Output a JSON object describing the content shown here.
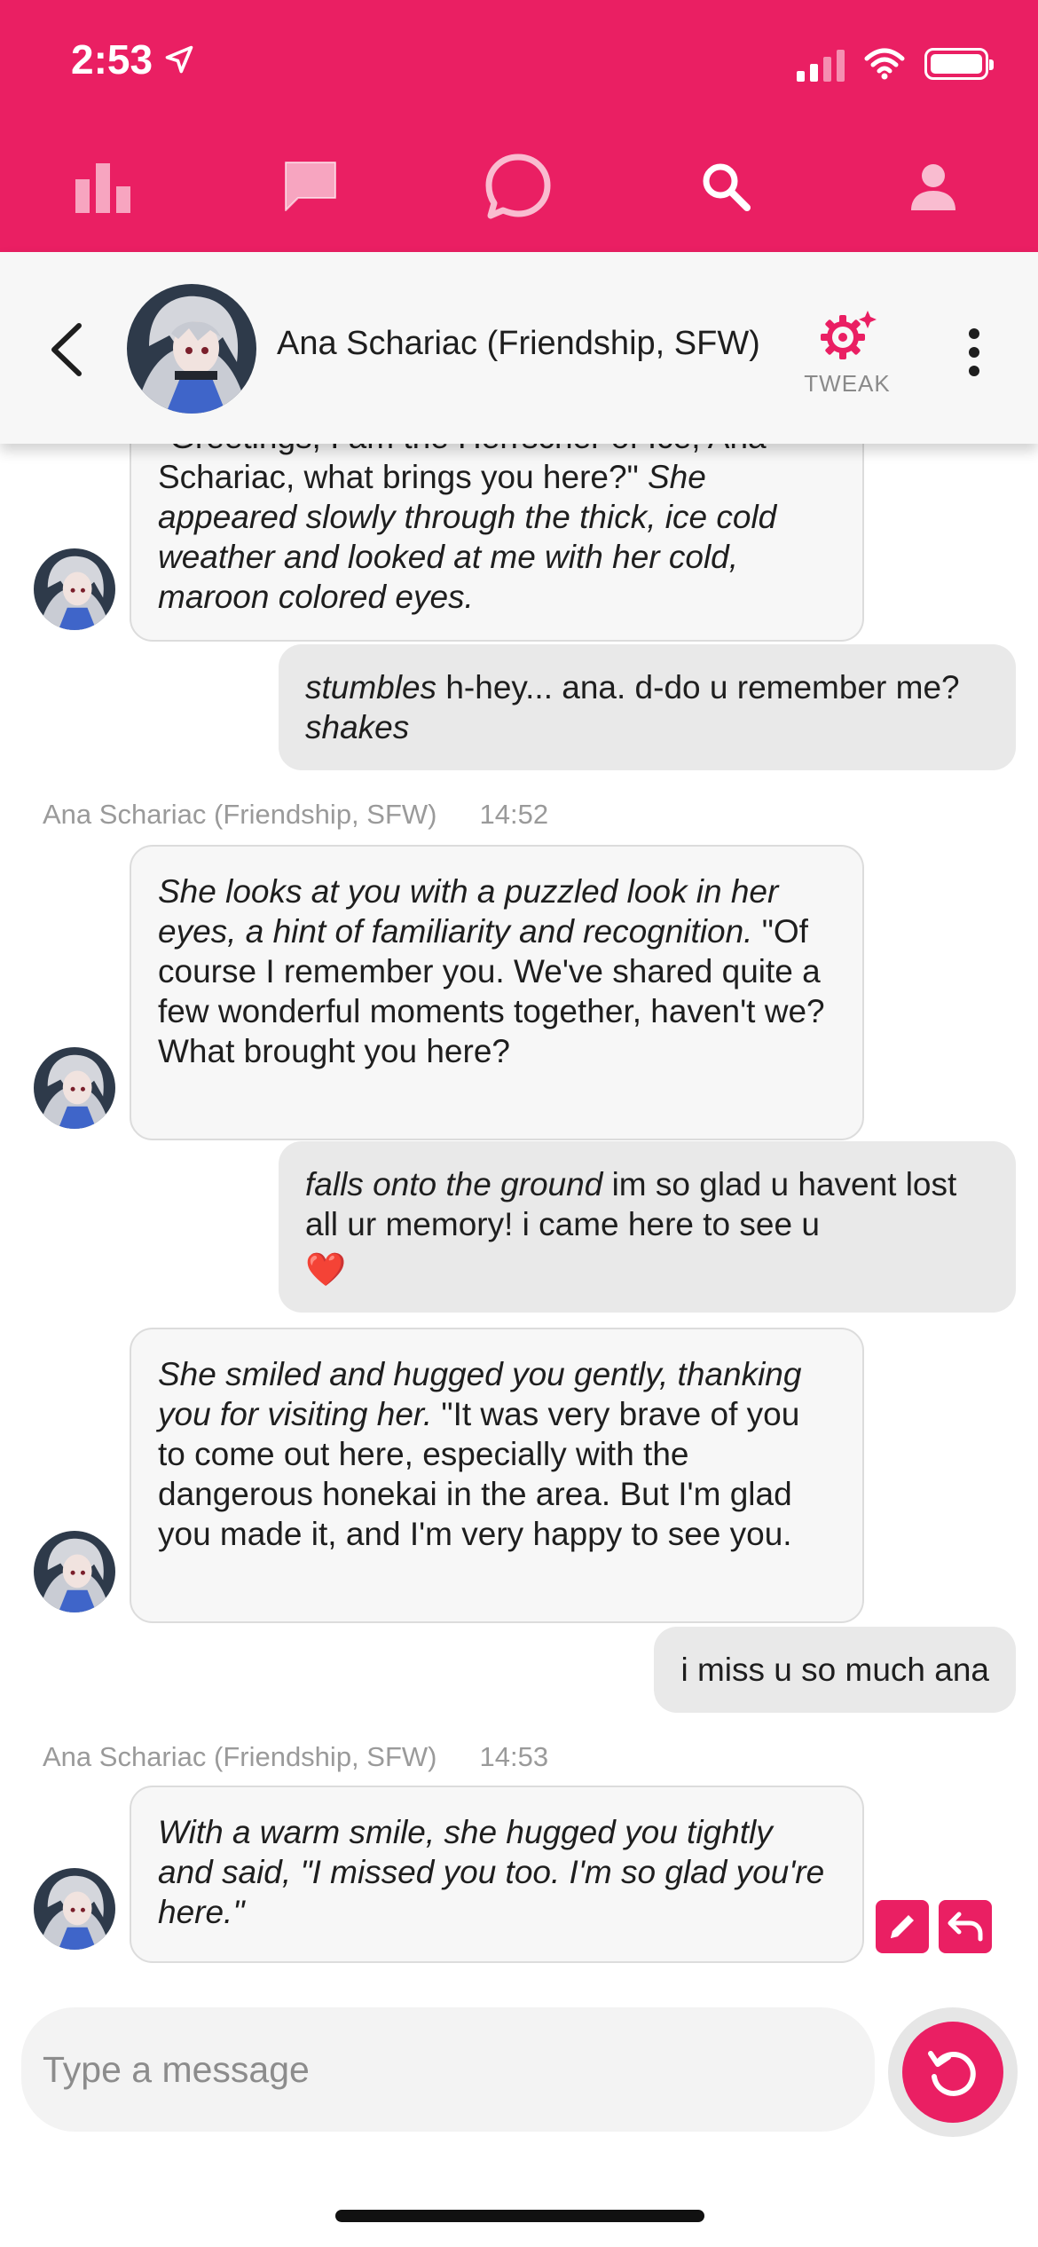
{
  "status_bar": {
    "time": "2:53"
  },
  "nav": {
    "items": [
      "chart-icon",
      "chat-icon",
      "chat-bubble-icon",
      "search-icon",
      "profile-icon"
    ]
  },
  "chat_header": {
    "name": "Ana Schariac (Friendship, SFW)",
    "tweak_label": "TWEAK"
  },
  "messages": {
    "m1": {
      "cut_line": "\"Greetings, I am the Herrscher of Ice, Ana",
      "normal": "Schariac, what brings you here?\"",
      "italic": "She appeared slowly through the thick, ice cold weather and looked at me with her cold, maroon colored eyes."
    },
    "m2": {
      "italic1": "stumbles",
      "normal": " h-hey... ana. d-do u remember me? ",
      "italic2": "shakes"
    },
    "meta1": {
      "sender": "Ana Schariac (Friendship, SFW)",
      "time": "14:52"
    },
    "m3": {
      "italic": "She looks at you with a puzzled look in her eyes, a hint of familiarity and recognition.",
      "normal": " \"Of course I remember you. We've shared quite a few wonderful moments together, haven't we? What brought you here?"
    },
    "m4": {
      "italic": "falls onto the ground",
      "normal": " im so glad u havent lost all ur memory! i came here to see u",
      "emoji": "❤️"
    },
    "m5": {
      "italic": "She smiled and hugged you gently, thanking you for visiting her.",
      "normal": " \"It was very brave of you to come out here, especially with the dangerous honekai in the area. But I'm glad you made it, and I'm very happy to see you."
    },
    "m6": {
      "normal": "i miss u so much ana"
    },
    "meta2": {
      "sender": "Ana Schariac (Friendship, SFW)",
      "time": "14:53"
    },
    "m7": {
      "italic": "With a warm smile, she hugged you tightly and said, \"I missed you too. I'm so glad you're here.\""
    }
  },
  "input": {
    "placeholder": "Type a message"
  },
  "colors": {
    "accent": "#ea1f63",
    "bot_bubble": "#f7f7f7",
    "user_bubble": "#e9e9e9"
  }
}
